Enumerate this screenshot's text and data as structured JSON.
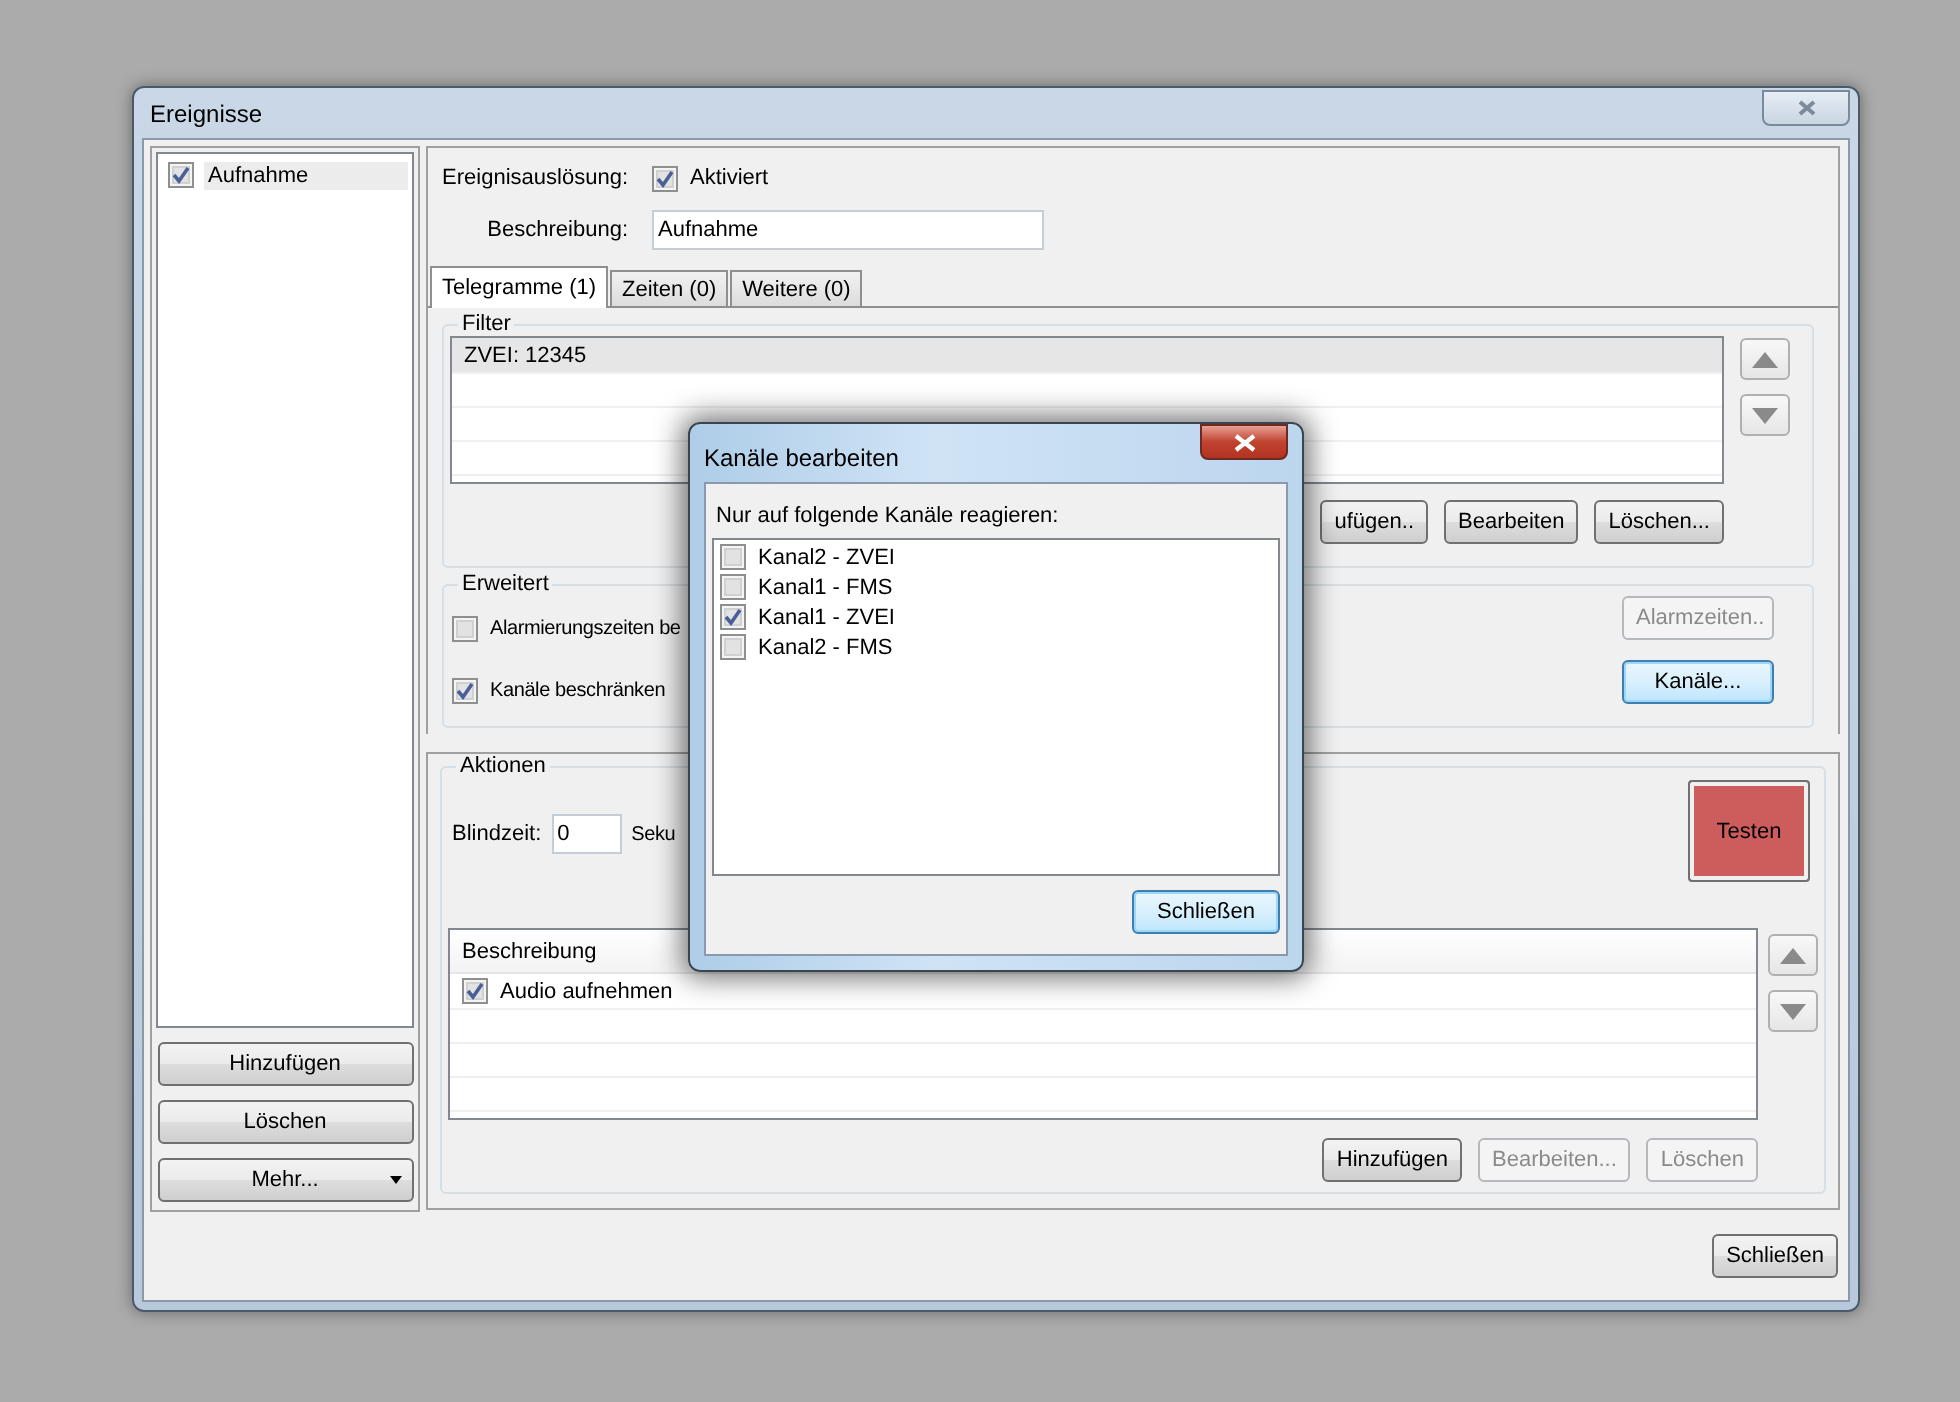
{
  "window": {
    "title": "Ereignisse"
  },
  "event_list": {
    "items": [
      {
        "label": "Aufnahme",
        "checked": true,
        "selected": true
      }
    ]
  },
  "event_buttons": [
    {
      "label": "Hinzufügen",
      "kind": "plain"
    },
    {
      "label": "Löschen",
      "kind": "plain"
    },
    {
      "label": "Mehr...",
      "kind": "dropdown"
    }
  ],
  "trigger": {
    "label": "Ereignisauslösung:",
    "checkbox_label": "Aktiviert",
    "checked": true
  },
  "description": {
    "label": "Beschreibung:",
    "value": "Aufnahme"
  },
  "tabs": [
    {
      "label": "Telegramme (1)",
      "selected": true
    },
    {
      "label": "Zeiten (0)",
      "selected": false
    },
    {
      "label": "Weitere (0)",
      "selected": false
    }
  ],
  "filter": {
    "title": "Filter",
    "rows": [
      {
        "text": "ZVEI: 12345",
        "selected": true
      }
    ],
    "buttons": [
      {
        "label": "ufügen..",
        "disabled": false,
        "focused": false
      },
      {
        "label": "Bearbeiten",
        "disabled": false,
        "focused": false
      },
      {
        "label": "Löschen...",
        "disabled": false,
        "focused": false
      }
    ]
  },
  "extended": {
    "title": "Erweitert",
    "options": [
      {
        "label": "Alarmierungszeiten be",
        "checked": false
      },
      {
        "label": "Kanäle beschränken",
        "checked": true
      }
    ],
    "buttons": [
      {
        "label": "Alarmzeiten..",
        "disabled": true,
        "focused": false
      },
      {
        "label": "Kanäle...",
        "disabled": false,
        "focused": true
      }
    ]
  },
  "actions": {
    "title": "Aktionen",
    "blind_label": "Blindzeit:",
    "blind_value": "0",
    "unit": "Seku",
    "test_button": "Testen",
    "list": {
      "header": "Beschreibung",
      "rows": [
        {
          "label": "Audio aufnehmen",
          "checked": true
        }
      ]
    },
    "buttons": [
      {
        "label": "Hinzufügen",
        "disabled": false,
        "focused": false
      },
      {
        "label": "Bearbeiten...",
        "disabled": true,
        "focused": false
      },
      {
        "label": "Löschen",
        "disabled": true,
        "focused": false
      }
    ]
  },
  "close_button": {
    "label": "Schließen",
    "disabled": false,
    "focused": false
  },
  "dialog": {
    "title": "Kanäle bearbeiten",
    "prompt": "Nur auf folgende Kanäle reagieren:",
    "channels": [
      {
        "label": "Kanal2 - ZVEI",
        "checked": false
      },
      {
        "label": "Kanal1 - FMS",
        "checked": false
      },
      {
        "label": "Kanal1 - ZVEI",
        "checked": true
      },
      {
        "label": "Kanal2 - FMS",
        "checked": false
      }
    ],
    "close_button": {
      "label": "Schließen",
      "disabled": false,
      "focused": true
    }
  }
}
